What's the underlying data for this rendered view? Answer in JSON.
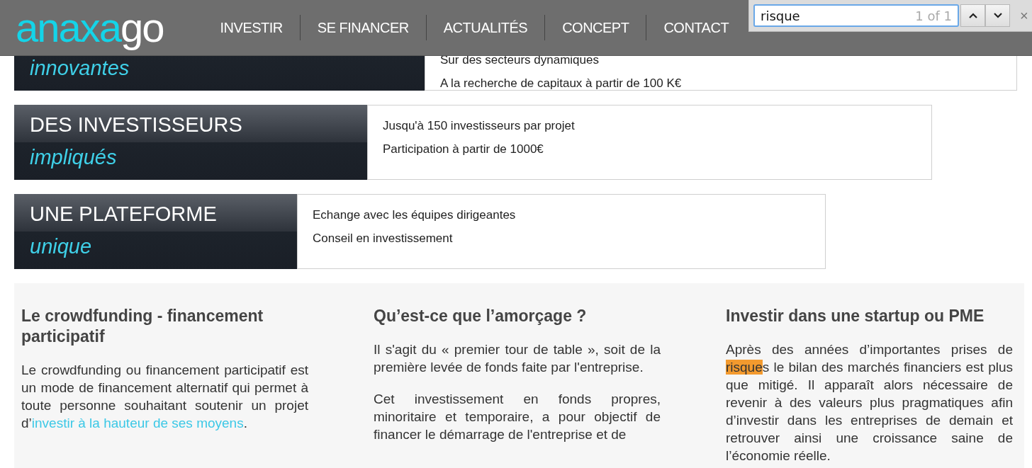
{
  "header": {
    "logo": {
      "primary": "anaxa",
      "secondary": "go"
    },
    "nav": [
      {
        "label": "INVESTIR"
      },
      {
        "label": "SE FINANCER"
      },
      {
        "label": "ACTUALITÉS"
      },
      {
        "label": "CONCEPT"
      },
      {
        "label": "CONTACT"
      }
    ]
  },
  "find_bar": {
    "query": "risque",
    "count": "1 of 1",
    "close": "×"
  },
  "features": [
    {
      "subtitle": "innovantes",
      "points": [
        "Sur des secteurs dynamiques",
        "A la recherche de capitaux à partir de 100 K€"
      ]
    },
    {
      "title": "DES INVESTISSEURS",
      "subtitle": "impliqués",
      "points": [
        "Jusqu'à 150 investisseurs par projet",
        "Participation à partir de 1000€"
      ]
    },
    {
      "title": "UNE PLATEFORME",
      "subtitle": "unique",
      "points": [
        "Echange avec les équipes dirigeantes",
        "Conseil en investissement"
      ]
    }
  ],
  "articles": [
    {
      "heading": "Le crowdfunding - financement participatif",
      "paragraphs": [
        [
          {
            "kind": "text",
            "text": "Le crowdfunding ou financement participatif est un mode de financement alternatif qui permet à toute personne souhaitant soutenir un projet d’"
          },
          {
            "kind": "link",
            "text": "investir à la hauteur de ses moyens"
          },
          {
            "kind": "text",
            "text": "."
          }
        ]
      ]
    },
    {
      "heading": "Qu’est-ce que l’amorçage ?",
      "paragraphs": [
        [
          {
            "kind": "text",
            "text": "Il s'agit du « premier tour de table », soit de la première levée de fonds faite par l'entreprise."
          }
        ],
        [
          {
            "kind": "text",
            "text": "Cet investissement en fonds propres, minoritaire et temporaire, a pour objectif de financer le démarrage de l'entreprise et de"
          }
        ]
      ]
    },
    {
      "heading": "Investir dans une startup ou PME",
      "paragraphs": [
        [
          {
            "kind": "text",
            "text": "Après des années d’importantes prises de "
          },
          {
            "kind": "match",
            "text": "risque"
          },
          {
            "kind": "text",
            "text": "s le bilan des marchés financiers est plus que mitigé. Il apparaît alors nécessaire de revenir à des valeurs plus pragmatiques afin d’investir dans les entreprises de demain et retrouver ainsi une croissance saine de l’économie réelle."
          }
        ]
      ]
    }
  ]
}
